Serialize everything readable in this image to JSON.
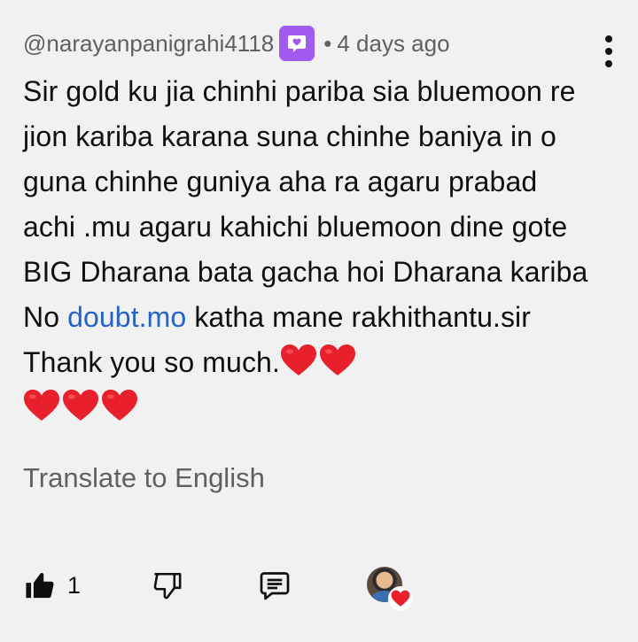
{
  "comment": {
    "author": "@narayanpanigrahi4118",
    "separator": "•",
    "timestamp": "4 days ago",
    "member_badge_icon": "member-badge-icon",
    "text_part1": "Sir gold ku jia chinhi pariba sia bluemoon re jion kariba karana suna chinhe baniya in o guna chinhe guniya aha ra agaru prabad achi .mu agaru kahichi bluemoon dine gote BIG Dharana bata gacha hoi Dharana kariba No ",
    "link_text": "doubt.mo",
    "text_part2": " katha mane rakhithantu.sir Thank you so much.",
    "hearts_inline": 2,
    "hearts_line2": 3,
    "heart_color": "#e8202b",
    "link_color": "#2563c8"
  },
  "translate": {
    "label": "Translate to English"
  },
  "actions": {
    "like_count": "1",
    "like_icon": "thumbs-up-icon",
    "dislike_icon": "thumbs-down-icon",
    "reply_icon": "reply-comment-icon",
    "creator_heart_icon": "creator-heart-icon"
  },
  "menu": {
    "icon": "more-vertical-icon"
  },
  "colors": {
    "background": "#f1f1f1",
    "secondary_text": "#606060",
    "badge": "#a25bf0"
  }
}
